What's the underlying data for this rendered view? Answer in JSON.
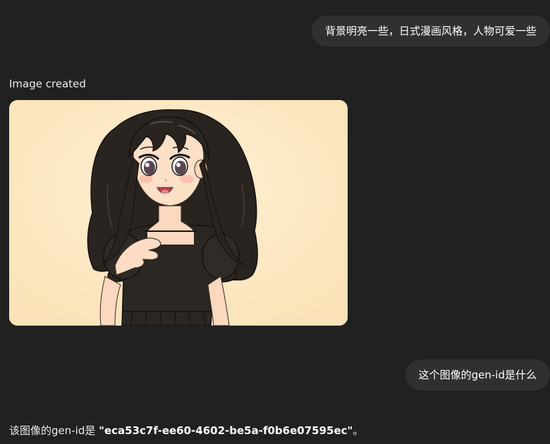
{
  "messages": {
    "user_1": "背景明亮一些，日式漫画风格，人物可爱一些",
    "image_status": "Image created",
    "user_2": "这个图像的gen-id是什么",
    "answer_prefix": "该图像的gen-id是 ",
    "answer_gen_id": "\"eca53c7f-ee60-4602-be5a-f0b6e07595ec\"",
    "answer_suffix": "。"
  },
  "colors": {
    "background": "#212121",
    "user_bubble": "#303030",
    "image_background": "#fde8c4"
  },
  "image": {
    "subject": "anime-girl-illustration"
  }
}
